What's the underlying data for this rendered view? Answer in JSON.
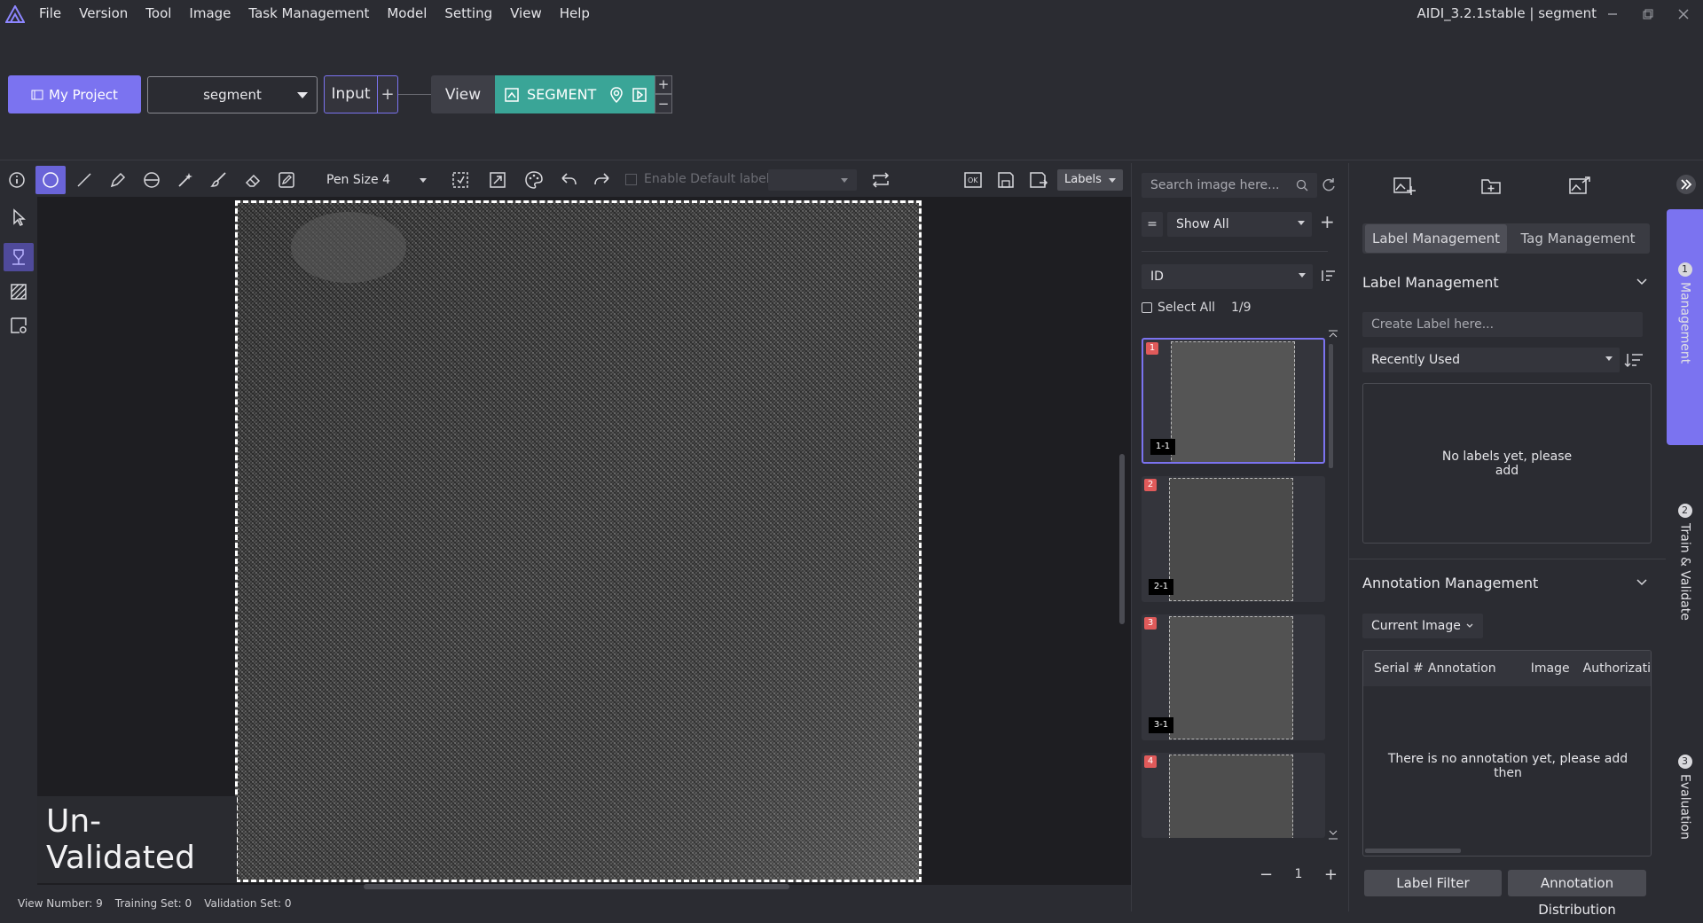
{
  "menubar": {
    "items": [
      "File",
      "Version",
      "Tool",
      "Image",
      "Task Management",
      "Model",
      "Setting",
      "View",
      "Help"
    ],
    "window_title": "AIDI_3.2.1stable | segment"
  },
  "pipeline": {
    "my_project": "My Project",
    "project_select": "segment",
    "input_node": "Input",
    "input_plus": "+",
    "view_node": "View",
    "segment_node": "SEGMENT",
    "plus": "+",
    "minus": "−"
  },
  "toolbar": {
    "pen_size": "Pen Size 4",
    "enable_default_label": "Enable Default label",
    "labels_select": "Labels"
  },
  "canvas": {
    "overlay_text": "Un-Validated"
  },
  "statusbar": {
    "view_number_label": "View Number:",
    "view_number": "9",
    "training_set_label": "Training Set:",
    "training_set": "0",
    "validation_set_label": "Validation Set:",
    "validation_set": "0"
  },
  "image_panel": {
    "search_placeholder": "Search image here...",
    "equals": "=",
    "filter": "Show All",
    "filter_plus": "+",
    "sort_by": "ID",
    "select_all": "Select All",
    "count": "1/9",
    "thumbnails": [
      {
        "index": "1",
        "tag": "1-1"
      },
      {
        "index": "2",
        "tag": "2-1"
      },
      {
        "index": "3",
        "tag": "3-1"
      },
      {
        "index": "4",
        "tag": ""
      }
    ],
    "page_minus": "−",
    "page": "1",
    "page_plus": "+"
  },
  "right_panel": {
    "tabs": [
      "Label Management",
      "Tag Management"
    ],
    "label_section_title": "Label Management",
    "create_label_placeholder": "Create Label here...",
    "recently_used": "Recently Used",
    "no_labels": "No labels yet, please add",
    "annotation_section_title": "Annotation Management",
    "current_image": "Current Image",
    "columns": [
      "Serial #",
      "Annotation",
      "Image",
      "Authorizati"
    ],
    "no_annotation": "There is no annotation yet, please add then",
    "label_filter": "Label Filter",
    "annotation_distribution": "Annotation Distribution"
  },
  "side_tabs": [
    {
      "num": "1",
      "label": "Management"
    },
    {
      "num": "2",
      "label": "Train & Validate"
    },
    {
      "num": "3",
      "label": "Evaluation"
    }
  ],
  "colors": {
    "accent": "#7b73f0",
    "segment": "#3aa597",
    "badge": "#e05a5a"
  }
}
